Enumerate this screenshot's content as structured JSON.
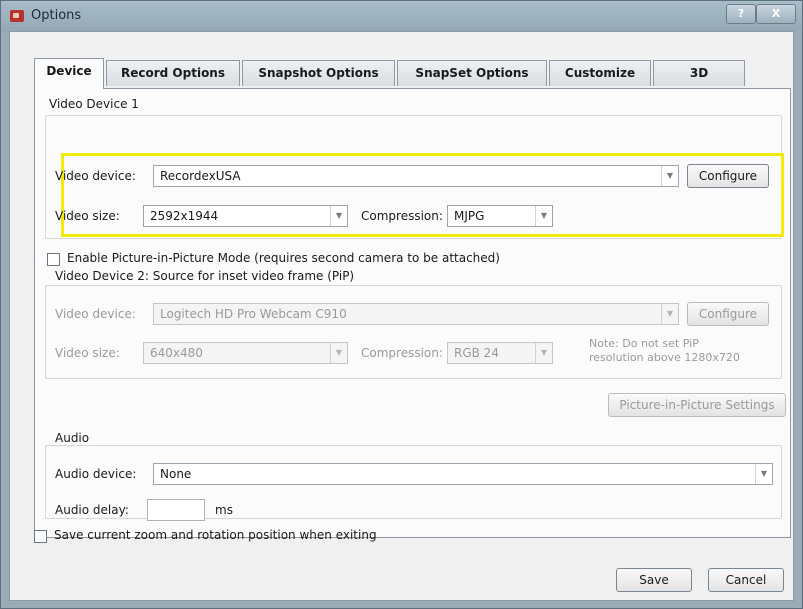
{
  "window": {
    "title": "Options",
    "help_label": "?",
    "close_label": "X"
  },
  "tabs": [
    "Device",
    "Record Options",
    "Snapshot Options",
    "SnapSet Options",
    "Customize",
    "3D"
  ],
  "video_device_1": {
    "group_label": "Video Device 1",
    "device_label": "Video device:",
    "device_value": "RecordexUSA",
    "configure_label": "Configure",
    "size_label": "Video size:",
    "size_value": "2592x1944",
    "compression_label": "Compression:",
    "compression_value": "MJPG"
  },
  "pip": {
    "checkbox_label": "Enable Picture-in-Picture Mode (requires second camera to be attached)",
    "group_label": "Video Device 2: Source for inset video frame (PiP)",
    "device_label": "Video device:",
    "device_value": "Logitech HD Pro Webcam C910",
    "configure_label": "Configure",
    "size_label": "Video size:",
    "size_value": "640x480",
    "compression_label": "Compression:",
    "compression_value": "RGB 24",
    "note_line1": "Note: Do not set PiP",
    "note_line2": "resolution above 1280x720",
    "settings_label": "Picture-in-Picture Settings"
  },
  "audio": {
    "group_label": "Audio",
    "device_label": "Audio device:",
    "device_value": "None",
    "delay_label": "Audio delay:",
    "delay_value": "",
    "delay_unit": "ms"
  },
  "save_zoom_label": "Save current zoom and rotation position when exiting",
  "footer": {
    "save_label": "Save",
    "cancel_label": "Cancel"
  }
}
